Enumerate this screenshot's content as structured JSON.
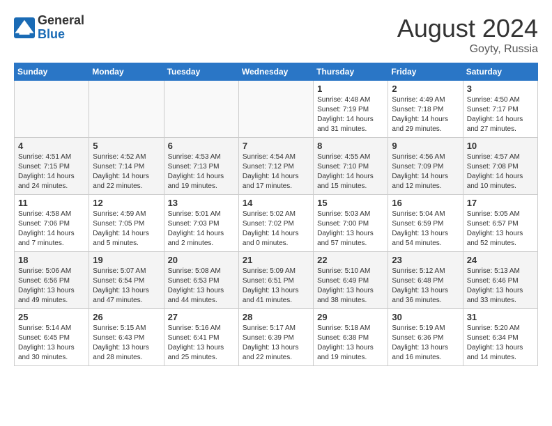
{
  "header": {
    "logo_general": "General",
    "logo_blue": "Blue",
    "month_year": "August 2024",
    "location": "Goyty, Russia"
  },
  "weekdays": [
    "Sunday",
    "Monday",
    "Tuesday",
    "Wednesday",
    "Thursday",
    "Friday",
    "Saturday"
  ],
  "weeks": [
    [
      {
        "day": "",
        "info": ""
      },
      {
        "day": "",
        "info": ""
      },
      {
        "day": "",
        "info": ""
      },
      {
        "day": "",
        "info": ""
      },
      {
        "day": "1",
        "info": "Sunrise: 4:48 AM\nSunset: 7:19 PM\nDaylight: 14 hours\nand 31 minutes."
      },
      {
        "day": "2",
        "info": "Sunrise: 4:49 AM\nSunset: 7:18 PM\nDaylight: 14 hours\nand 29 minutes."
      },
      {
        "day": "3",
        "info": "Sunrise: 4:50 AM\nSunset: 7:17 PM\nDaylight: 14 hours\nand 27 minutes."
      }
    ],
    [
      {
        "day": "4",
        "info": "Sunrise: 4:51 AM\nSunset: 7:15 PM\nDaylight: 14 hours\nand 24 minutes."
      },
      {
        "day": "5",
        "info": "Sunrise: 4:52 AM\nSunset: 7:14 PM\nDaylight: 14 hours\nand 22 minutes."
      },
      {
        "day": "6",
        "info": "Sunrise: 4:53 AM\nSunset: 7:13 PM\nDaylight: 14 hours\nand 19 minutes."
      },
      {
        "day": "7",
        "info": "Sunrise: 4:54 AM\nSunset: 7:12 PM\nDaylight: 14 hours\nand 17 minutes."
      },
      {
        "day": "8",
        "info": "Sunrise: 4:55 AM\nSunset: 7:10 PM\nDaylight: 14 hours\nand 15 minutes."
      },
      {
        "day": "9",
        "info": "Sunrise: 4:56 AM\nSunset: 7:09 PM\nDaylight: 14 hours\nand 12 minutes."
      },
      {
        "day": "10",
        "info": "Sunrise: 4:57 AM\nSunset: 7:08 PM\nDaylight: 14 hours\nand 10 minutes."
      }
    ],
    [
      {
        "day": "11",
        "info": "Sunrise: 4:58 AM\nSunset: 7:06 PM\nDaylight: 14 hours\nand 7 minutes."
      },
      {
        "day": "12",
        "info": "Sunrise: 4:59 AM\nSunset: 7:05 PM\nDaylight: 14 hours\nand 5 minutes."
      },
      {
        "day": "13",
        "info": "Sunrise: 5:01 AM\nSunset: 7:03 PM\nDaylight: 14 hours\nand 2 minutes."
      },
      {
        "day": "14",
        "info": "Sunrise: 5:02 AM\nSunset: 7:02 PM\nDaylight: 14 hours\nand 0 minutes."
      },
      {
        "day": "15",
        "info": "Sunrise: 5:03 AM\nSunset: 7:00 PM\nDaylight: 13 hours\nand 57 minutes."
      },
      {
        "day": "16",
        "info": "Sunrise: 5:04 AM\nSunset: 6:59 PM\nDaylight: 13 hours\nand 54 minutes."
      },
      {
        "day": "17",
        "info": "Sunrise: 5:05 AM\nSunset: 6:57 PM\nDaylight: 13 hours\nand 52 minutes."
      }
    ],
    [
      {
        "day": "18",
        "info": "Sunrise: 5:06 AM\nSunset: 6:56 PM\nDaylight: 13 hours\nand 49 minutes."
      },
      {
        "day": "19",
        "info": "Sunrise: 5:07 AM\nSunset: 6:54 PM\nDaylight: 13 hours\nand 47 minutes."
      },
      {
        "day": "20",
        "info": "Sunrise: 5:08 AM\nSunset: 6:53 PM\nDaylight: 13 hours\nand 44 minutes."
      },
      {
        "day": "21",
        "info": "Sunrise: 5:09 AM\nSunset: 6:51 PM\nDaylight: 13 hours\nand 41 minutes."
      },
      {
        "day": "22",
        "info": "Sunrise: 5:10 AM\nSunset: 6:49 PM\nDaylight: 13 hours\nand 38 minutes."
      },
      {
        "day": "23",
        "info": "Sunrise: 5:12 AM\nSunset: 6:48 PM\nDaylight: 13 hours\nand 36 minutes."
      },
      {
        "day": "24",
        "info": "Sunrise: 5:13 AM\nSunset: 6:46 PM\nDaylight: 13 hours\nand 33 minutes."
      }
    ],
    [
      {
        "day": "25",
        "info": "Sunrise: 5:14 AM\nSunset: 6:45 PM\nDaylight: 13 hours\nand 30 minutes."
      },
      {
        "day": "26",
        "info": "Sunrise: 5:15 AM\nSunset: 6:43 PM\nDaylight: 13 hours\nand 28 minutes."
      },
      {
        "day": "27",
        "info": "Sunrise: 5:16 AM\nSunset: 6:41 PM\nDaylight: 13 hours\nand 25 minutes."
      },
      {
        "day": "28",
        "info": "Sunrise: 5:17 AM\nSunset: 6:39 PM\nDaylight: 13 hours\nand 22 minutes."
      },
      {
        "day": "29",
        "info": "Sunrise: 5:18 AM\nSunset: 6:38 PM\nDaylight: 13 hours\nand 19 minutes."
      },
      {
        "day": "30",
        "info": "Sunrise: 5:19 AM\nSunset: 6:36 PM\nDaylight: 13 hours\nand 16 minutes."
      },
      {
        "day": "31",
        "info": "Sunrise: 5:20 AM\nSunset: 6:34 PM\nDaylight: 13 hours\nand 14 minutes."
      }
    ]
  ]
}
